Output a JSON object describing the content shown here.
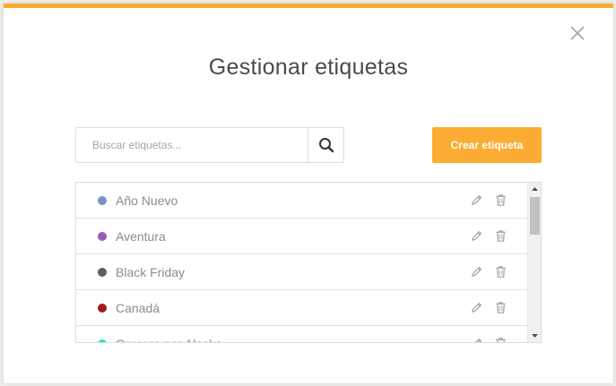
{
  "modal": {
    "title": "Gestionar etiquetas",
    "accent_color": "#f9ac2e"
  },
  "search": {
    "placeholder": "Buscar etiquetas...",
    "value": ""
  },
  "create_button": {
    "label": "Crear etiqueta",
    "color": "#fbad33"
  },
  "tags": [
    {
      "label": "Año Nuevo",
      "color": "#7c91c8"
    },
    {
      "label": "Aventura",
      "color": "#9b59b6"
    },
    {
      "label": "Black Friday",
      "color": "#5e5e5e"
    },
    {
      "label": "Canadá",
      "color": "#9b1c1c"
    },
    {
      "label": "Crucero por Alaska",
      "color": "#1de9b6"
    }
  ],
  "icons": {
    "close": "close-icon",
    "search": "search-icon",
    "edit": "pencil-icon",
    "delete": "trash-icon"
  }
}
